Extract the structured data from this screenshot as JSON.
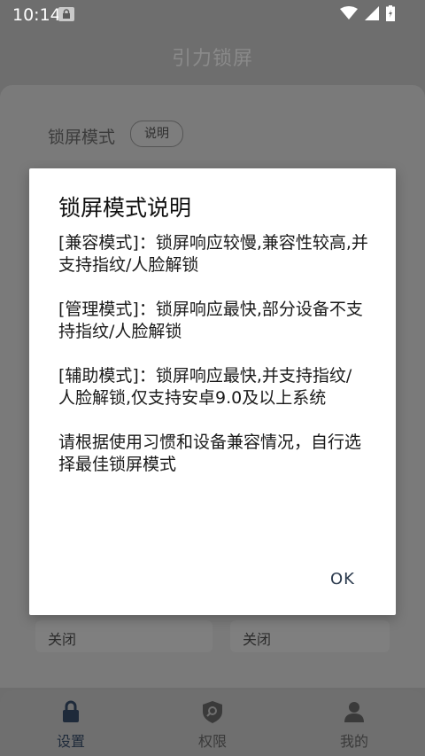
{
  "status_bar": {
    "time": "10:14",
    "icons": [
      "lock-badge-icon",
      "wifi-icon",
      "signal-icon",
      "battery-charging-icon"
    ]
  },
  "app": {
    "title": "引力锁屏"
  },
  "settings": {
    "mode_label": "锁屏模式",
    "explain_button": "说明",
    "toggle_left": "关闭",
    "toggle_right": "关闭"
  },
  "dialog": {
    "title": "锁屏模式说明",
    "paragraphs": [
      "[兼容模式]：锁屏响应较慢,兼容性较高,并支持指纹/人脸解锁",
      "[管理模式]：锁屏响应最快,部分设备不支持指纹/人脸解锁",
      "[辅助模式]：锁屏响应最快,并支持指纹/人脸解锁,仅支持安卓9.0及以上系统",
      "请根据使用习惯和设备兼容情况，自行选择最佳锁屏模式"
    ],
    "ok_label": "OK"
  },
  "bottom_nav": {
    "items": [
      {
        "label": "设置",
        "icon": "lock-icon",
        "active": true
      },
      {
        "label": "权限",
        "icon": "shield-search-icon",
        "active": false
      },
      {
        "label": "我的",
        "icon": "person-icon",
        "active": false
      }
    ]
  },
  "colors": {
    "scrim": "#6e6e6e",
    "dialog_bg": "#ffffff",
    "ok_text": "#2b3a4d",
    "nav_active": "#1e2a3a"
  }
}
